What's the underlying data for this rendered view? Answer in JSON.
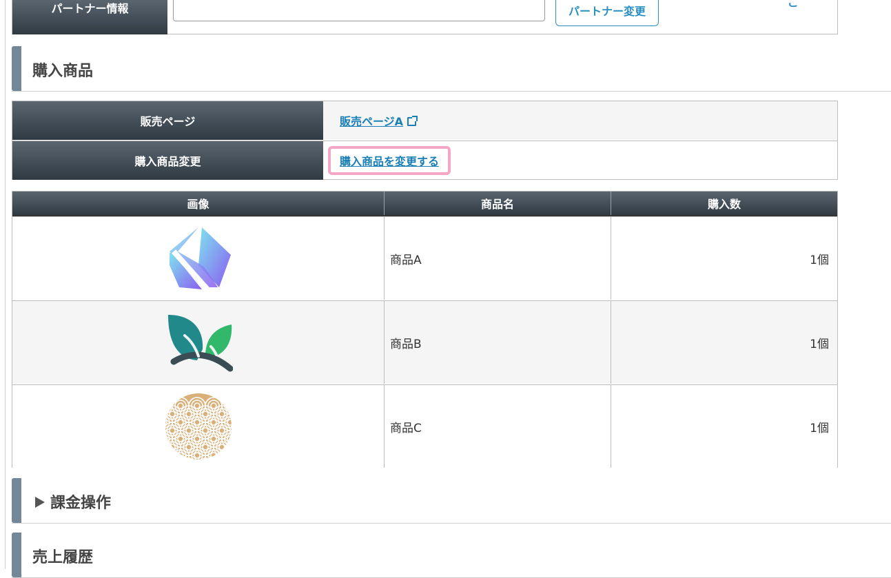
{
  "partner": {
    "label": "パートナー情報",
    "input_value": "",
    "change_button": "パートナー変更",
    "right_fragment": "ご"
  },
  "sections": {
    "purchased_products": "購入商品",
    "billing_ops": "課金操作",
    "sales_history": "売上履歴"
  },
  "info": {
    "sales_page_label": "販売ページ",
    "sales_page_link": "販売ページA",
    "change_label": "購入商品変更",
    "change_link": "購入商品を変更する"
  },
  "products": {
    "headers": [
      "画像",
      "商品名",
      "購入数"
    ],
    "rows": [
      {
        "icon": "gem-icon",
        "name": "商品A",
        "qty": "1個"
      },
      {
        "icon": "leaf-icon",
        "name": "商品B",
        "qty": "1個"
      },
      {
        "icon": "wave-pattern-icon",
        "name": "商品C",
        "qty": "1個"
      }
    ]
  },
  "colors": {
    "link": "#1a7fb5",
    "highlight": "#f5a5c5",
    "section_bar": "#728797"
  }
}
